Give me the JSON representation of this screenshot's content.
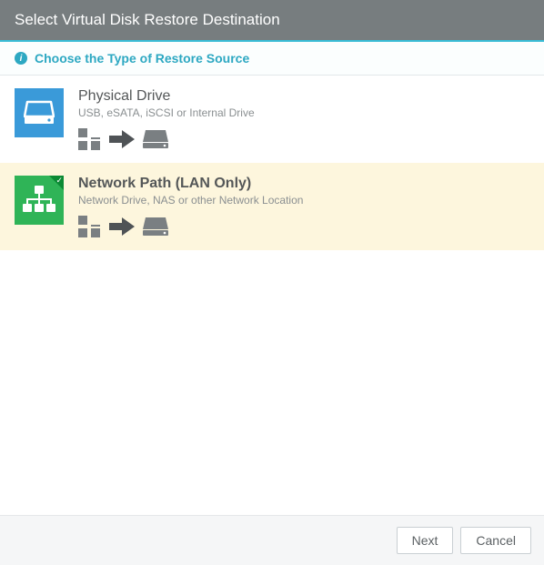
{
  "title": "Select Virtual Disk Restore Destination",
  "subheader": "Choose the Type of Restore Source",
  "options": [
    {
      "title": "Physical Drive",
      "desc": "USB, eSATA, iSCSI or Internal Drive"
    },
    {
      "title": "Network Path (LAN Only)",
      "desc": "Network Drive, NAS or other Network Location"
    }
  ],
  "buttons": {
    "next": "Next",
    "cancel": "Cancel"
  }
}
